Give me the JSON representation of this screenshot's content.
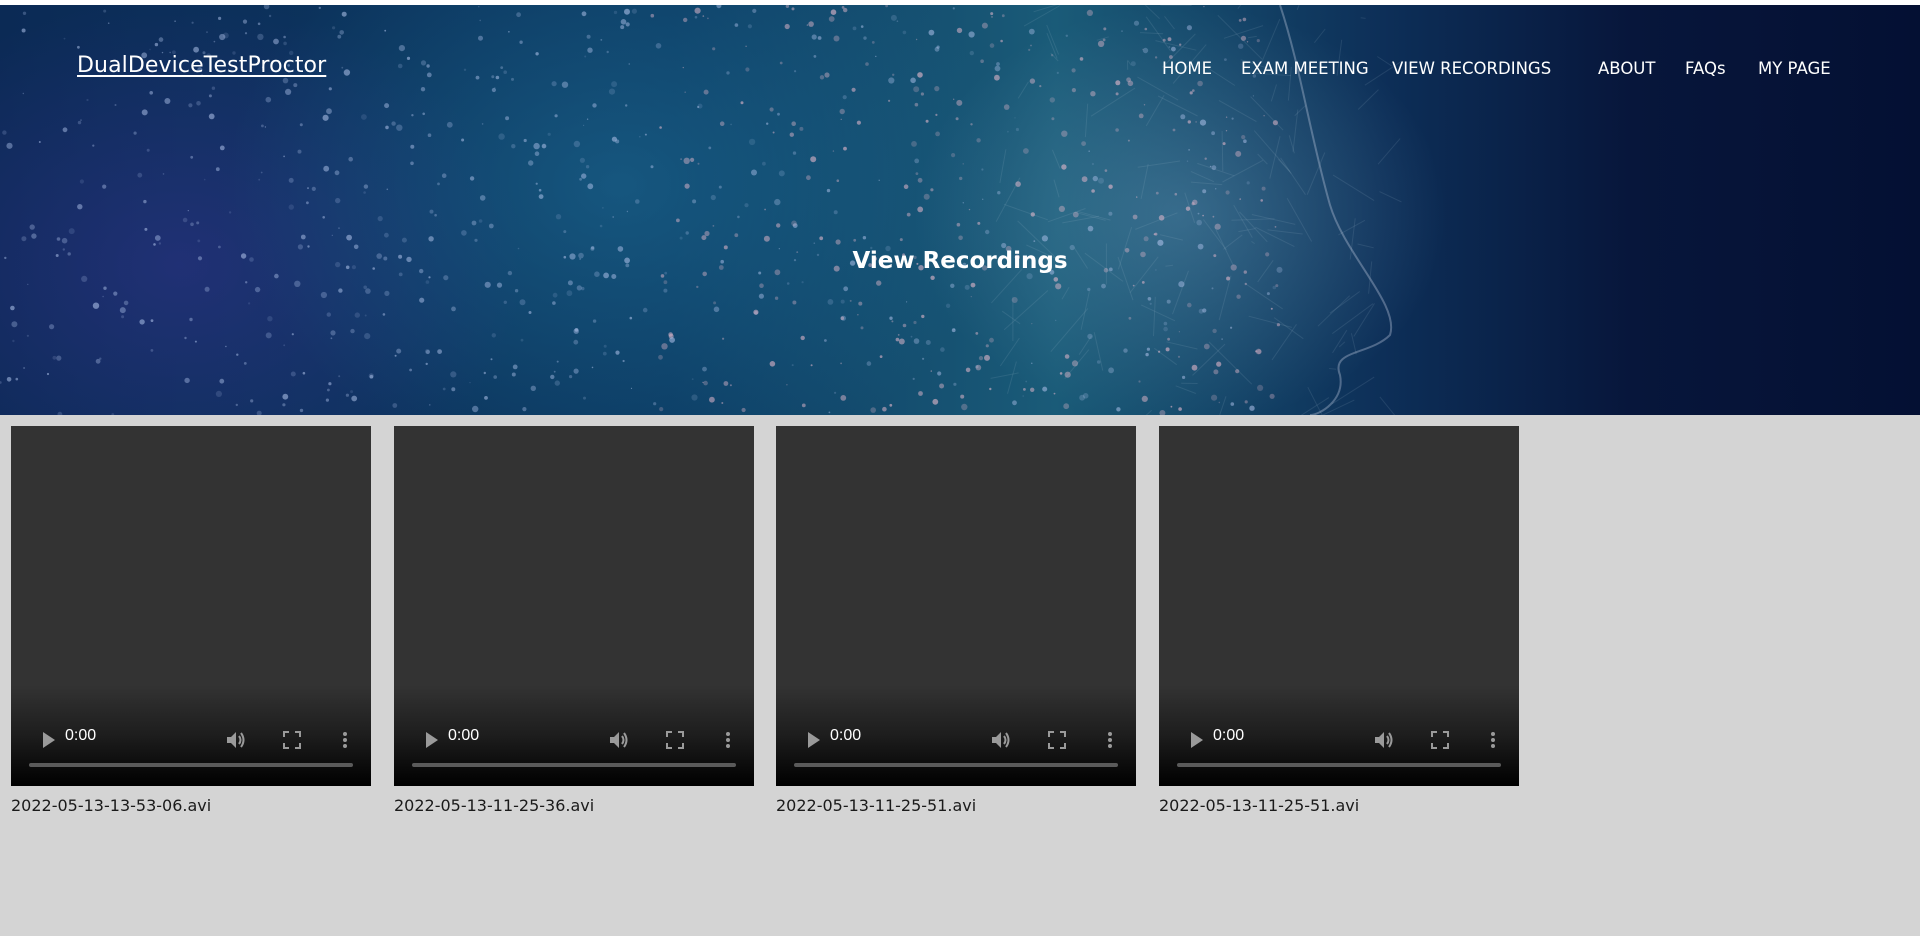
{
  "header": {
    "logo_text": "DualDeviceTestProctor",
    "nav": [
      {
        "label": "HOME"
      },
      {
        "label": "EXAM MEETING"
      },
      {
        "label": "VIEW RECORDINGS"
      },
      {
        "label": "ABOUT"
      },
      {
        "label": "FAQs"
      },
      {
        "label": "MY PAGE"
      }
    ]
  },
  "hero": {
    "title": "View Recordings"
  },
  "recordings": [
    {
      "time": "0:00",
      "filename": "2022-05-13-13-53-06.avi"
    },
    {
      "time": "0:00",
      "filename": "2022-05-13-11-25-36.avi"
    },
    {
      "time": "0:00",
      "filename": "2022-05-13-11-25-51.avi"
    },
    {
      "time": "0:00",
      "filename": "2022-05-13-11-25-51.avi"
    }
  ],
  "icons": {
    "play": "play-icon",
    "volume": "volume-icon",
    "fullscreen": "fullscreen-icon",
    "more": "more-vertical-icon"
  },
  "colors": {
    "page_background": "#d4d4d4",
    "video_background": "#333333",
    "nav_text": "#ffffff"
  }
}
